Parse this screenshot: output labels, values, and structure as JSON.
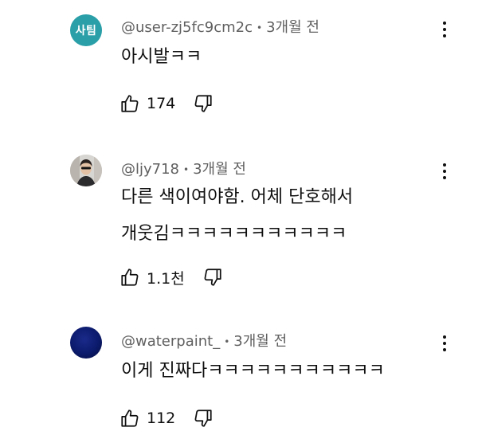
{
  "comments": [
    {
      "avatar_text": "사팀",
      "avatar_color": "#2a9fa8",
      "author": "@user-zj5fc9cm2c",
      "time": "3개월 전",
      "lines": [
        "아시발ㅋㅋ"
      ],
      "likes": "174"
    },
    {
      "author": "@ljy718",
      "time": "3개월 전",
      "lines": [
        "다른 색이여야함. 어체 단호해서",
        "개웃김ㅋㅋㅋㅋㅋㅋㅋㅋㅋㅋㅋ"
      ],
      "likes": "1.1천"
    },
    {
      "avatar_color": "#0b1a6b",
      "author": "@waterpaint_",
      "time": "3개월 전",
      "lines": [
        "이게 진짜다ㅋㅋㅋㅋㅋㅋㅋㅋㅋㅋㅋ"
      ],
      "likes": "112"
    }
  ],
  "icons": {
    "more": "more-vert-icon",
    "like": "thumb-up-icon",
    "dislike": "thumb-down-icon"
  }
}
